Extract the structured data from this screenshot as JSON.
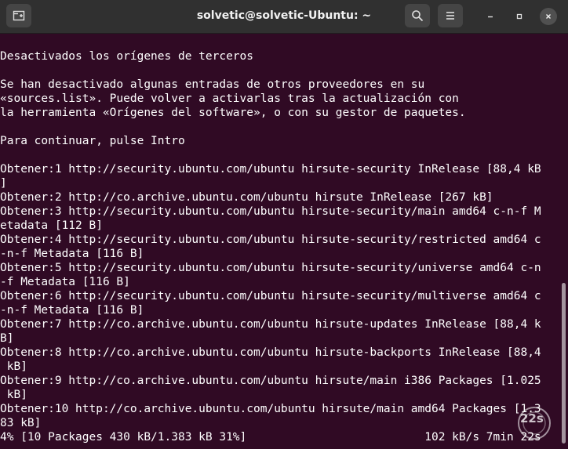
{
  "window": {
    "title": "solvetic@solvetic-Ubuntu: ~",
    "new_tab_icon": "new-tab-icon",
    "search_icon": "search-icon",
    "menu_icon": "hamburger-menu-icon"
  },
  "terminal": {
    "background": "#300a24",
    "foreground": "#ffffff",
    "lines": [
      "Desactivados los orígenes de terceros",
      "",
      "Se han desactivado algunas entradas de otros proveedores en su",
      "«sources.list». Puede volver a activarlas tras la actualización con",
      "la herramienta «Orígenes del software», o con su gestor de paquetes.",
      "",
      "Para continuar, pulse Intro",
      "",
      "Obtener:1 http://security.ubuntu.com/ubuntu hirsute-security InRelease [88,4 kB",
      "]",
      "Obtener:2 http://co.archive.ubuntu.com/ubuntu hirsute InRelease [267 kB]",
      "Obtener:3 http://security.ubuntu.com/ubuntu hirsute-security/main amd64 c-n-f M",
      "etadata [112 B]",
      "Obtener:4 http://security.ubuntu.com/ubuntu hirsute-security/restricted amd64 c",
      "-n-f Metadata [116 B]",
      "Obtener:5 http://security.ubuntu.com/ubuntu hirsute-security/universe amd64 c-n",
      "-f Metadata [116 B]",
      "Obtener:6 http://security.ubuntu.com/ubuntu hirsute-security/multiverse amd64 c",
      "-n-f Metadata [116 B]",
      "Obtener:7 http://co.archive.ubuntu.com/ubuntu hirsute-updates InRelease [88,4 k",
      "B]",
      "Obtener:8 http://co.archive.ubuntu.com/ubuntu hirsute-backports InRelease [88,4",
      " kB]",
      "Obtener:9 http://co.archive.ubuntu.com/ubuntu hirsute/main i386 Packages [1.025",
      " kB]",
      "Obtener:10 http://co.archive.ubuntu.com/ubuntu hirsute/main amd64 Packages [1.3",
      "83 kB]",
      "4% [10 Packages 430 kB/1.383 kB 31%]                          102 kB/s 7min 22s"
    ]
  },
  "watermark": {
    "text": "22s"
  }
}
